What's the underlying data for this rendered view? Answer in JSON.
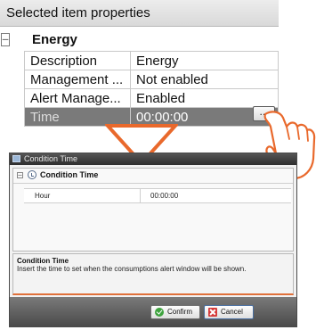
{
  "properties_panel": {
    "title": "Selected item properties",
    "category": {
      "expander": "–",
      "label": "Energy"
    },
    "rows": [
      {
        "key": "Description",
        "value": "Energy"
      },
      {
        "key": "Management ...",
        "value": "Not enabled"
      },
      {
        "key": "Alert Manage...",
        "value": "Enabled"
      },
      {
        "key": "Time",
        "value": "00:00:00"
      }
    ],
    "ellipsis_label": "..."
  },
  "dialog": {
    "title": "Condition Time",
    "grid": {
      "expander": "–",
      "category_label": "Condition Time",
      "row": {
        "key": "Hour",
        "value": "00:00:00"
      }
    },
    "help": {
      "heading": "Condition Time",
      "text": "Insert the time to set when the consumptions alert window will be shown."
    },
    "buttons": {
      "confirm": "Confirm",
      "cancel": "Cancel"
    }
  },
  "colors": {
    "selected_row": "#7a7a7a",
    "arrow": "#e9692c",
    "help_border": "#e0703a",
    "confirm_icon": "#3ea33e",
    "cancel_icon": "#d63a3a"
  },
  "icons": [
    "clock-icon",
    "confirm-check-icon",
    "cancel-x-icon",
    "pointing-hand-icon",
    "down-arrow-icon",
    "app-icon"
  ]
}
